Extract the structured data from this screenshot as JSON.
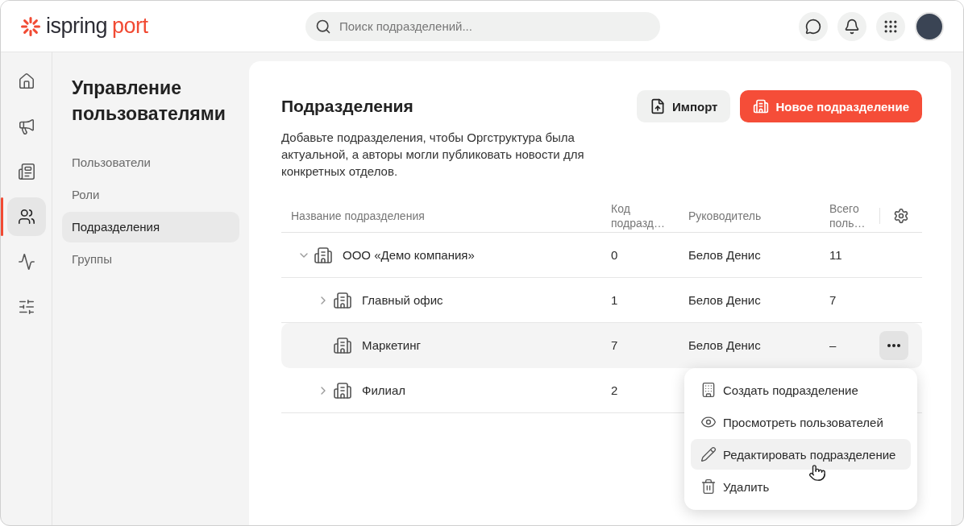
{
  "header": {
    "logo": {
      "main": "ispring",
      "accent": "port"
    },
    "search": {
      "placeholder": "Поиск подразделений..."
    }
  },
  "rail": [
    {
      "selected": false
    },
    {
      "selected": false
    },
    {
      "selected": false
    },
    {
      "selected": true
    },
    {
      "selected": false
    },
    {
      "selected": false
    }
  ],
  "nav": {
    "title": "Управление пользователями",
    "items": [
      {
        "label": "Пользователи",
        "selected": false
      },
      {
        "label": "Роли",
        "selected": false
      },
      {
        "label": "Подразделения",
        "selected": true
      },
      {
        "label": "Группы",
        "selected": false
      }
    ]
  },
  "page": {
    "title": "Подразделения",
    "description": "Добавьте подразделения, чтобы Оргструктура была актуальной, а авторы могли публиковать новости для конкретных отделов.",
    "buttons": [
      {
        "label": "Импорт",
        "kind": "secondary"
      },
      {
        "label": "Новое подразделение",
        "kind": "primary"
      }
    ]
  },
  "table": {
    "columns": [
      "Название подразделения",
      "Код подразд…",
      "Руководитель",
      "Всего поль…"
    ],
    "rows": [
      {
        "name": "ООО «Демо компания»",
        "code": "0",
        "manager": "Белов Денис",
        "total": "11",
        "expanded": true,
        "selected": false,
        "children": [
          {
            "name": "Главный офис",
            "code": "1",
            "manager": "Белов Денис",
            "total": "7",
            "expanded": false,
            "selected": false
          },
          {
            "name": "Маркетинг",
            "code": "7",
            "manager": "Белов Денис",
            "total": "–",
            "selected": true
          },
          {
            "name": "Филиал",
            "code": "2",
            "expanded": false,
            "selected": false
          }
        ]
      }
    ]
  },
  "menu": {
    "items": [
      {
        "label": "Создать подразделение",
        "selected": false
      },
      {
        "label": "Просмотреть пользователей",
        "selected": false
      },
      {
        "label": "Редактировать подразделение",
        "selected": true
      },
      {
        "label": "Удалить",
        "selected": false
      }
    ]
  }
}
